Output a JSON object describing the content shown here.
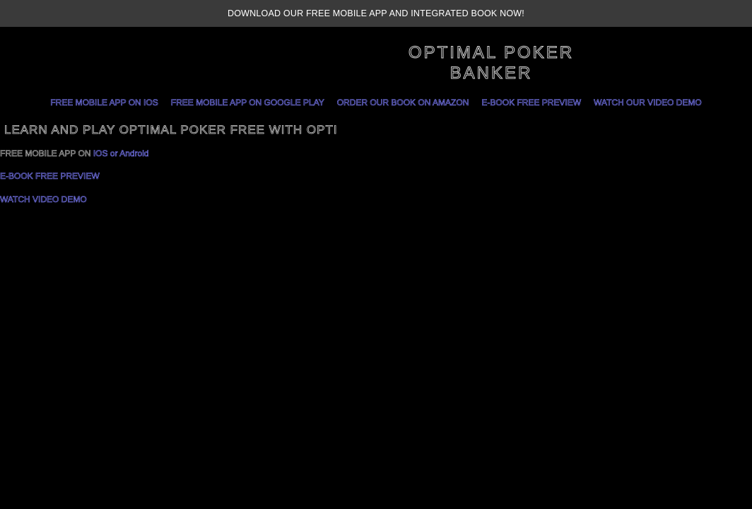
{
  "banner": {
    "text": "DOWNLOAD OUR FREE MOBILE APP AND INTEGRATED BOOK NOW!"
  },
  "site": {
    "title_line1": "OPTIMAL POKER",
    "title_line2": "BANKER"
  },
  "nav": {
    "items": [
      {
        "label": "FREE MOBILE APP ON IOS"
      },
      {
        "label": "FREE MOBILE APP ON GOOGLE PLAY"
      },
      {
        "label": "ORDER OUR BOOK ON AMAZON"
      },
      {
        "label": "E-BOOK FREE PREVIEW"
      },
      {
        "label": "WATCH OUR VIDEO DEMO"
      }
    ]
  },
  "main": {
    "heading": "LEARN AND PLAY OPTIMAL POKER FREE WITH OPTI",
    "app_prefix": "FREE MOBILE APP ON ",
    "app_ios_link": "IOS",
    "app_or": " or ",
    "app_android_link": "Android",
    "ebook_link": "E-BOOK FREE PREVIEW",
    "video_link": "WATCH VIDEO DEMO"
  },
  "colors": {
    "background": "#000000",
    "banner_bg": "#3a3a3a",
    "link_outline": "#7f7fff",
    "text_outline": "#c8c8c8"
  }
}
